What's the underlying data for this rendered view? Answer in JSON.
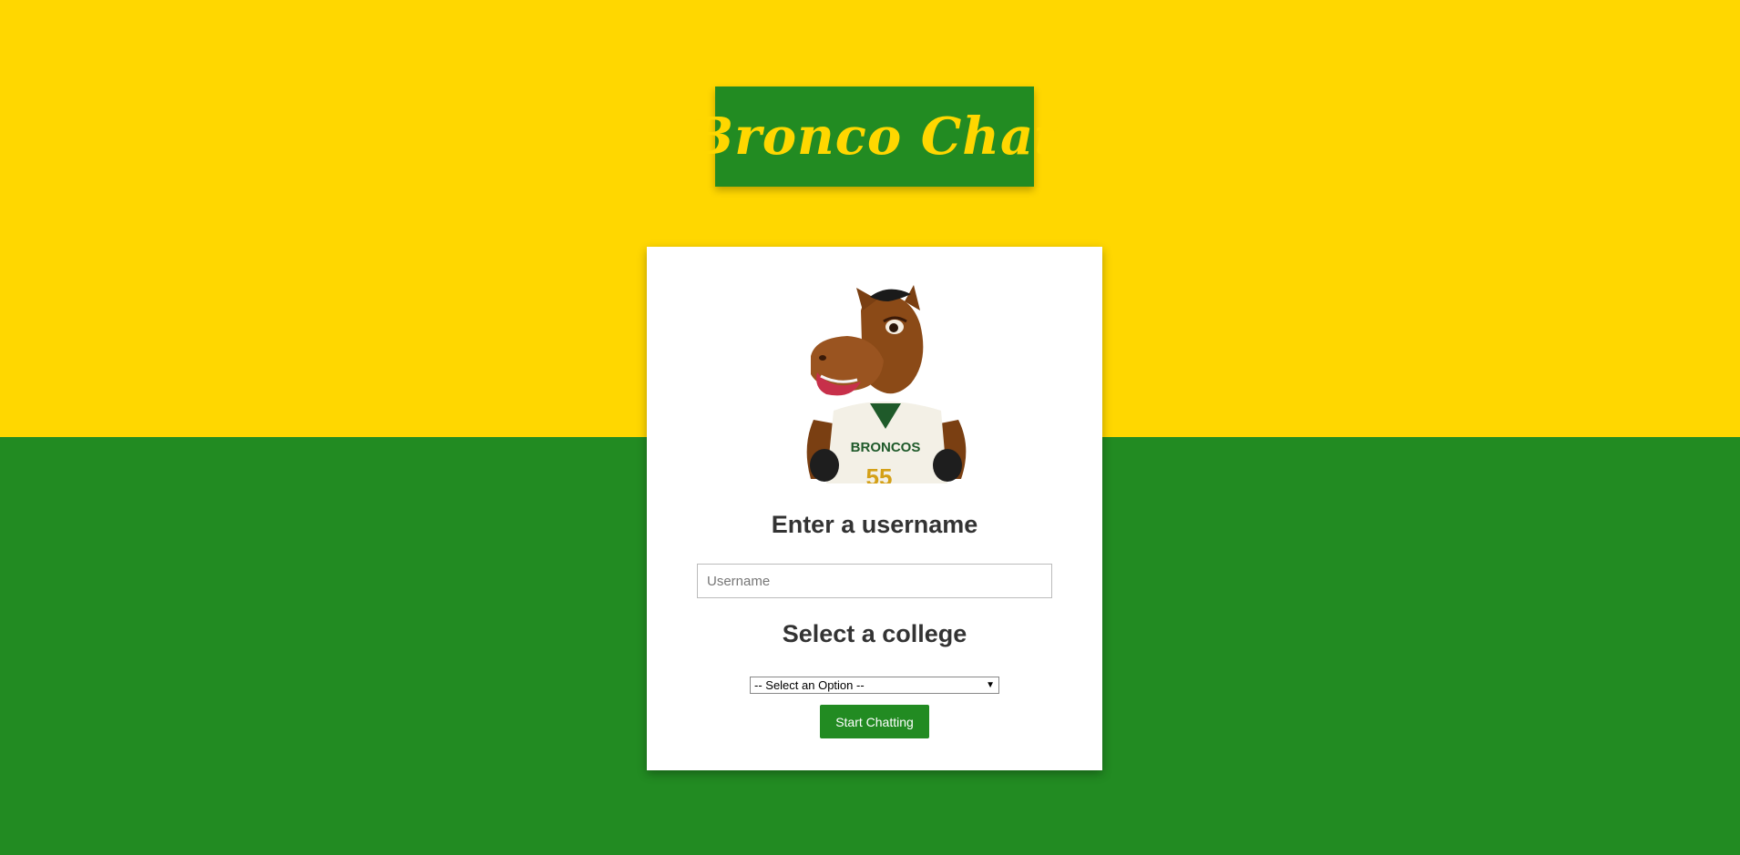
{
  "app": {
    "logo_text": "Bronco Chat"
  },
  "colors": {
    "gold": "#FFD700",
    "green": "#228B22",
    "card": "#FFFFFF"
  },
  "form": {
    "username_heading": "Enter a username",
    "username_placeholder": "Username",
    "username_value": "",
    "college_heading": "Select a college",
    "college_selected": "-- Select an Option --",
    "submit_label": "Start Chatting"
  },
  "mascot": {
    "jersey_text": "BRONCOS",
    "jersey_number": "55"
  }
}
